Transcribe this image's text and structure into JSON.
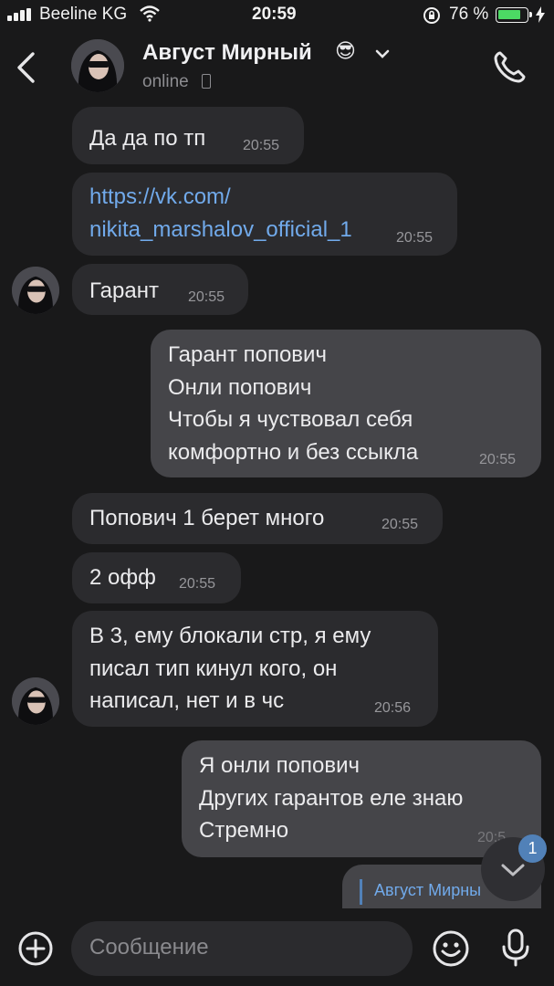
{
  "status_bar": {
    "carrier": "Beeline KG",
    "time": "20:59",
    "battery": "76 %"
  },
  "header": {
    "name": "Август Мирный",
    "emoji": "😎",
    "presence": "online"
  },
  "messages": [
    {
      "text": "Да да по тп",
      "time": "20:55"
    },
    {
      "text": "https://vk.com/\nnikita_marshalov_official_1",
      "time": "20:55"
    },
    {
      "text": "Гарант",
      "time": "20:55"
    },
    {
      "text": "Гарант попович\nОнли попович\nЧтобы я чуствовал себя\nкомфортно и без ссыкла",
      "time": "20:55"
    },
    {
      "text": "Попович 1 берет много",
      "time": "20:55"
    },
    {
      "text": "2 офф",
      "time": "20:55"
    },
    {
      "text": "В 3, ему блокали стр, я ему\nписал тип кинул кого, он\nнаписал, нет и в чс",
      "time": "20:56"
    },
    {
      "text": "Я онли попович\nДругих гарантов еле знаю\nСтремно",
      "time": "20:5"
    },
    {
      "reply_name": "Август Мирны"
    }
  ],
  "scroll_badge": "1",
  "composer": {
    "placeholder": "Сообщение"
  },
  "colors": {
    "background": "#19191a",
    "incoming": "#2b2b2e",
    "outgoing": "#454549",
    "link": "#71aaeb",
    "badge": "#5181b8"
  }
}
